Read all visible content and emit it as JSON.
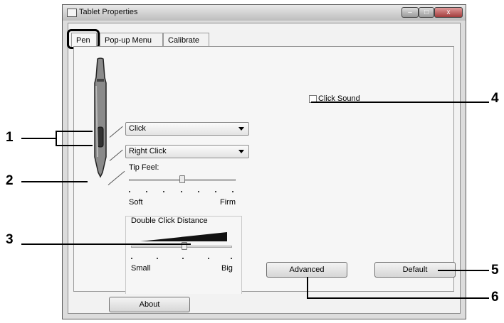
{
  "window": {
    "title": "Tablet Properties",
    "controls": {
      "minimize": "–",
      "maximize": "□",
      "close": "x"
    }
  },
  "tabs": [
    {
      "label": "Pen"
    },
    {
      "label": "Pop-up Menu"
    },
    {
      "label": "Calibrate"
    }
  ],
  "pen_buttons": {
    "upper_selected": "Click",
    "lower_selected": "Right Click"
  },
  "tip_feel": {
    "label": "Tip Feel:",
    "min_label": "Soft",
    "max_label": "Firm",
    "level_fraction": 0.5
  },
  "double_click": {
    "label": "Double Click Distance",
    "min_label": "Small",
    "max_label": "Big",
    "level_fraction": 0.5
  },
  "click_sound": {
    "label": "Click Sound",
    "checked": false
  },
  "buttons": {
    "advanced": "Advanced",
    "default": "Default",
    "about": "About"
  },
  "callouts": [
    "1",
    "2",
    "3",
    "4",
    "5",
    "6"
  ]
}
